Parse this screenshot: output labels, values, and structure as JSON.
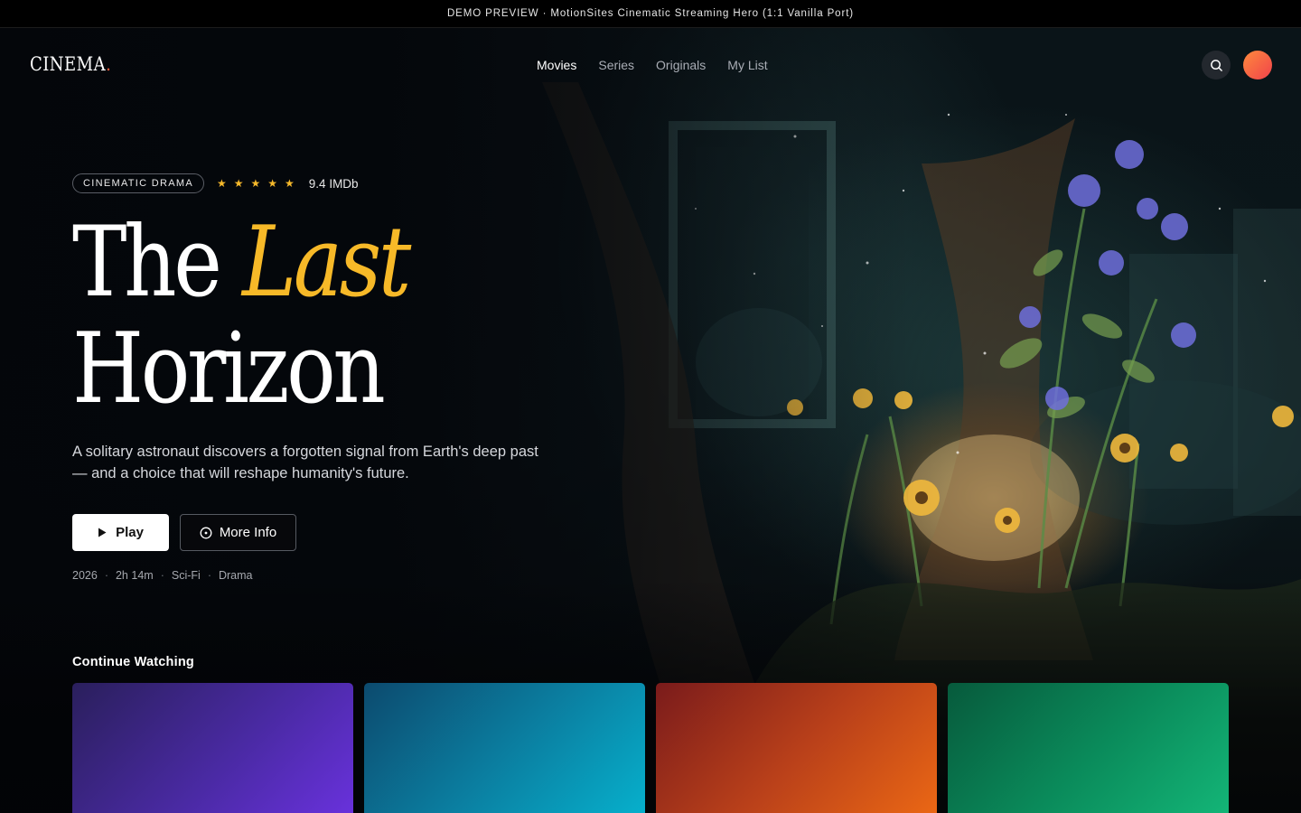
{
  "banner": {
    "text": "DEMO PREVIEW · MotionSites Cinematic Streaming Hero (1:1 Vanilla Port)"
  },
  "nav": {
    "logo": "CINEMA",
    "logo_dot": ".",
    "links": [
      {
        "label": "Movies",
        "active": true
      },
      {
        "label": "Series",
        "active": false
      },
      {
        "label": "Originals",
        "active": false
      },
      {
        "label": "My List",
        "active": false
      }
    ],
    "search_icon": "search-icon",
    "avatar_colors": [
      "#ff8a3d",
      "#f0424b"
    ]
  },
  "hero": {
    "genre": "CINEMATIC DRAMA",
    "star_count": 5,
    "star_glyph": "★",
    "rating": "9.4 IMDb",
    "title_part1": "The",
    "title_accent": "Last",
    "title_part2": "Horizon",
    "description": "A solitary astronaut discovers a forgotten signal from Earth's deep past — and a choice that will reshape humanity's future.",
    "play_label": "Play",
    "info_label": "More Info",
    "facts": [
      "2026",
      "2h 14m",
      "Sci-Fi",
      "Drama"
    ],
    "fact_separator": "·",
    "accent_color": "#f7b928"
  },
  "continue_watching": {
    "title": "Continue Watching",
    "cards": [
      {
        "colors": [
          "#2a1f5c",
          "#6b32e0"
        ]
      },
      {
        "colors": [
          "#0c4a6e",
          "#06b3cf"
        ]
      },
      {
        "colors": [
          "#7a1b1b",
          "#ee6a14"
        ]
      },
      {
        "colors": [
          "#075a3c",
          "#14b879"
        ]
      }
    ]
  }
}
